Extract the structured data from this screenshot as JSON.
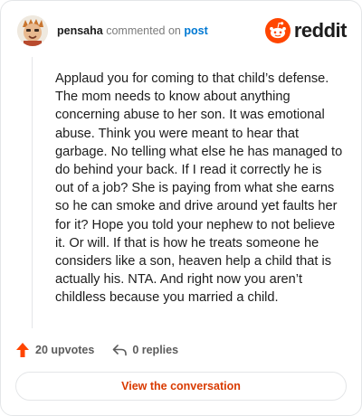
{
  "header": {
    "username": "pensaha",
    "verb": "commented on",
    "target": "post",
    "brand": "reddit"
  },
  "icons": {
    "avatar": "avatar-image",
    "brand": "reddit-alien-icon",
    "upvote": "upvote-arrow-icon",
    "reply": "reply-arrow-icon"
  },
  "colors": {
    "brand_orange": "#ff4500",
    "link_blue": "#0079d3",
    "button_text": "#d93a00"
  },
  "comment": {
    "body": "Applaud you for coming to that child’s defense. The mom needs to know about anything concerning abuse to her son. It was emotional abuse. Think you were meant to hear that garbage. No telling what else he has managed to do behind your back. If I read it correctly he is out of a job? She is paying from what she earns so he can smoke and drive around yet faults her for it? Hope you told your nephew to not believe it. Or will. If that is how he treats someone he considers like a son, heaven help a child that is actually his. NTA. And right now you aren’t childless because you married a child."
  },
  "actions": {
    "upvotes": "20 upvotes",
    "replies": "0 replies"
  },
  "footer": {
    "button_label": "View the conversation"
  }
}
